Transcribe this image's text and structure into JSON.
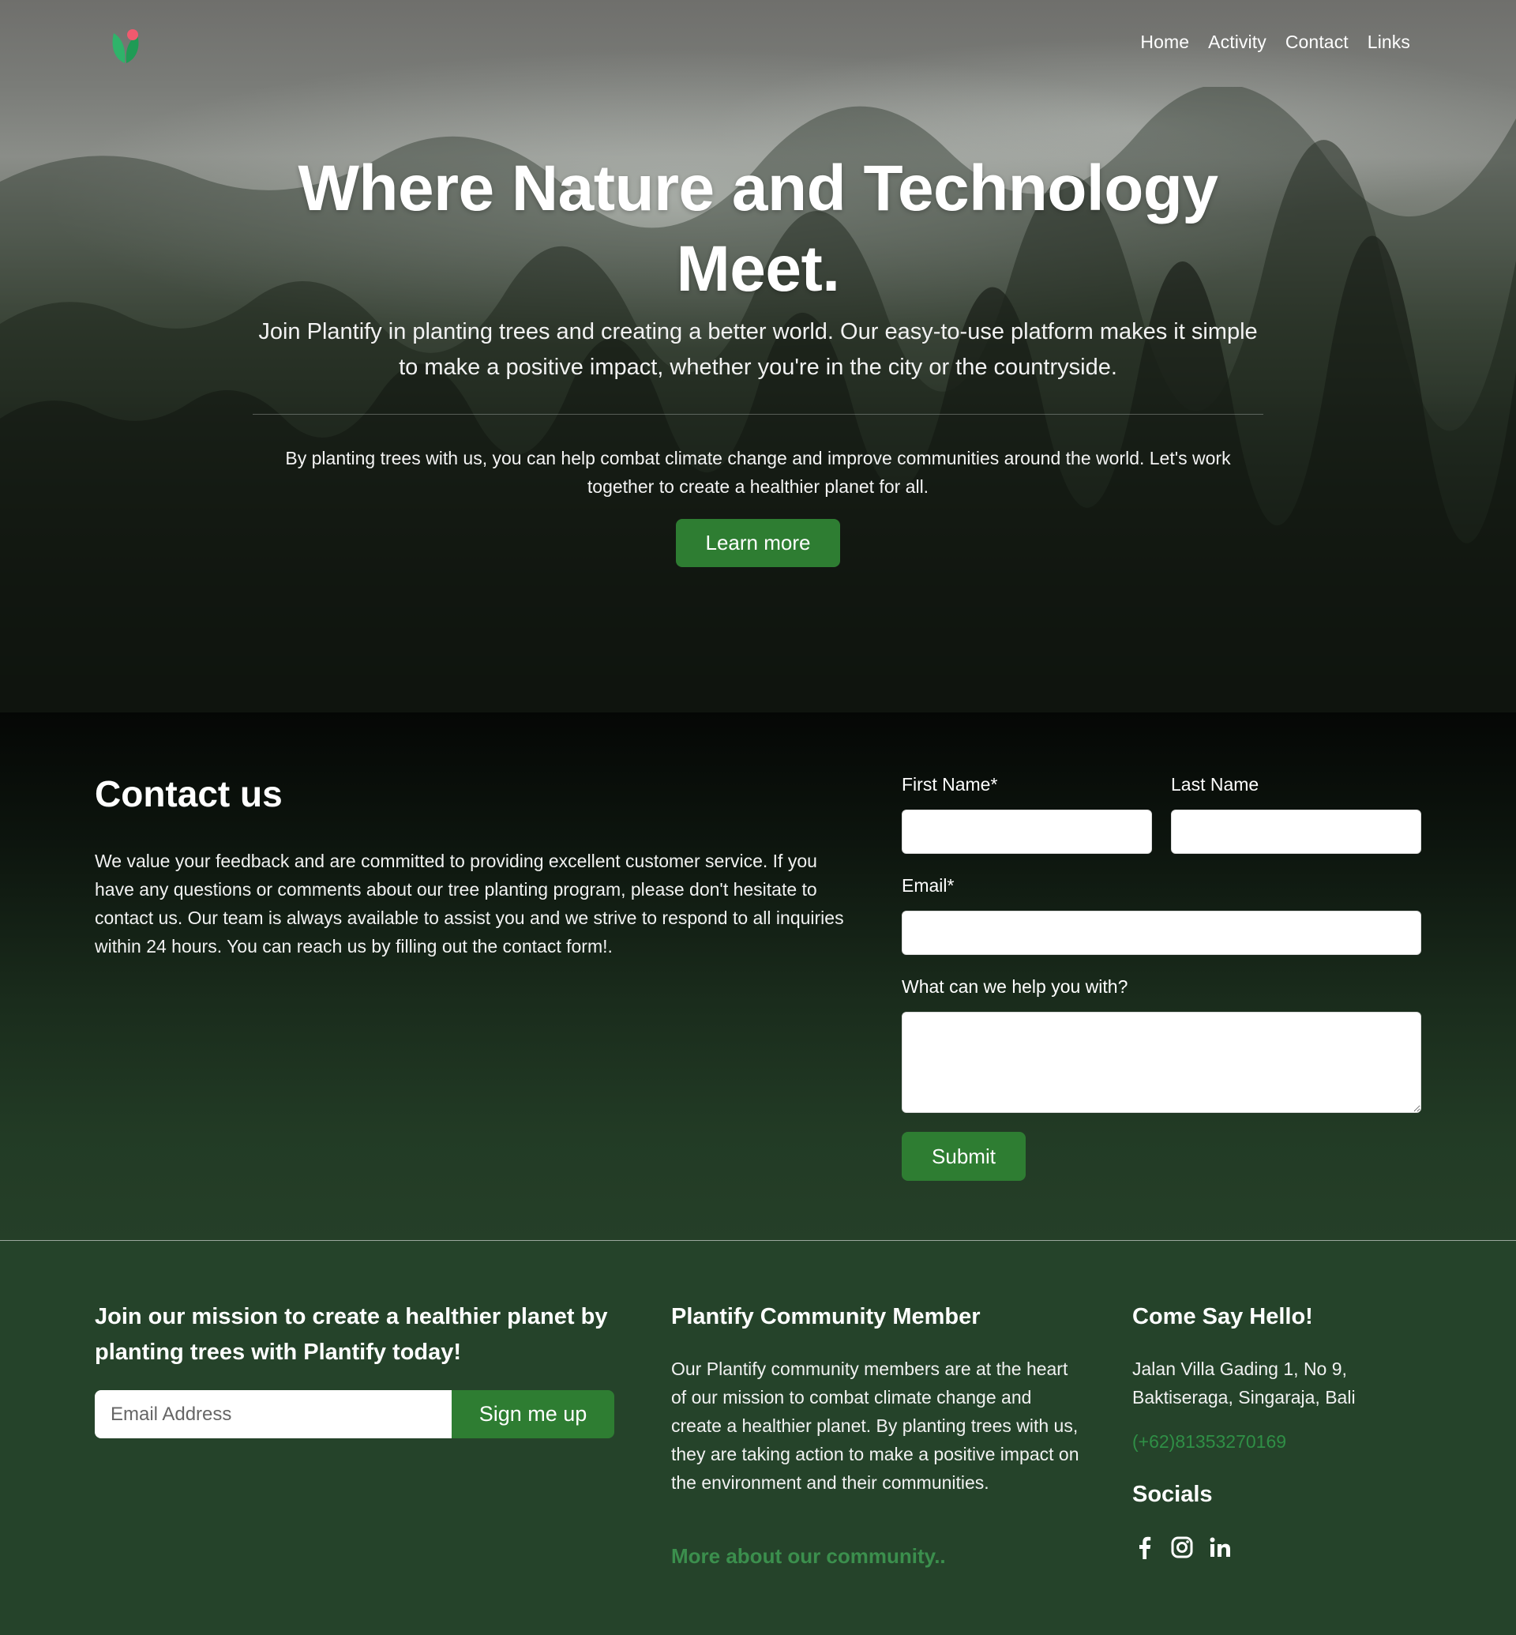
{
  "nav": {
    "links": [
      "Home",
      "Activity",
      "Contact",
      "Links"
    ]
  },
  "hero": {
    "title": "Where Nature and Technology Meet.",
    "lead": "Join Plantify in planting trees and creating a better world. Our easy-to-use platform makes it simple to make a positive impact, whether you're in the city or the countryside.",
    "subtext": "By planting trees with us, you can help combat climate change and improve communities around the world. Let's work together to create a healthier planet for all.",
    "button_label": "Learn more"
  },
  "contact": {
    "heading": "Contact us",
    "text": "We value your feedback and are committed to providing excellent customer service. If you have any questions or comments about our tree planting program, please don't hesitate to contact us. Our team is always available to assist you and we strive to respond to all inquiries within 24 hours. You can reach us by filling out the contact form!.",
    "form": {
      "first_name_label": "First Name*",
      "last_name_label": "Last Name",
      "email_label": "Email*",
      "message_label": "What can we help you with?",
      "first_name_value": "",
      "last_name_value": "",
      "email_value": "",
      "message_value": "",
      "submit_label": "Submit"
    }
  },
  "footer": {
    "mission_title": "Join our mission to create a healthier planet by planting trees with Plantify today!",
    "email_placeholder": "Email Address",
    "signup_label": "Sign me up",
    "community_title": "Plantify Community Member",
    "community_text": "Our Plantify community members are at the heart of our mission to combat climate change and create a healthier planet. By planting trees with us, they are taking action to make a positive impact on the environment and their communities.",
    "community_link": "More about our community..",
    "hello_title": "Come Say Hello!",
    "address": "Jalan Villa Gading 1, No 9, Baktiseraga, Singaraja, Bali",
    "phone": "(+62)81353270169",
    "socials_title": "Socials",
    "socials": [
      "facebook-icon",
      "instagram-icon",
      "linkedin-icon"
    ]
  },
  "colors": {
    "accent_green": "#2e7d32",
    "footer_bg": "#25432a",
    "link_green": "#3b8f4d"
  }
}
